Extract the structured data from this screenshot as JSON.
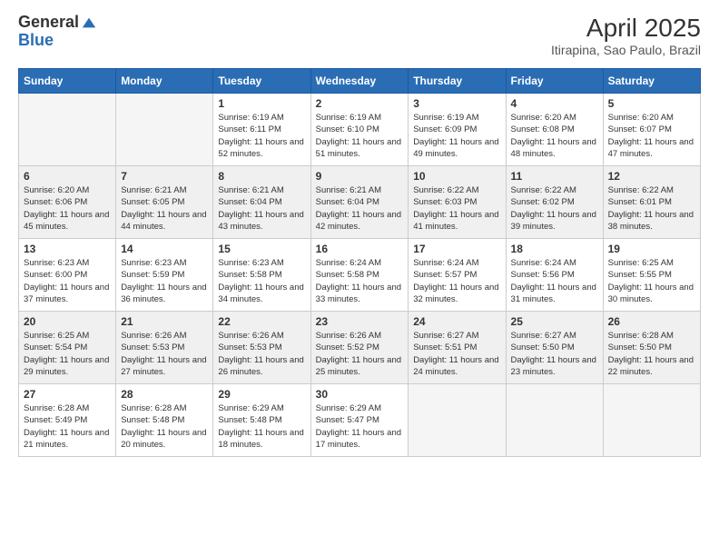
{
  "logo": {
    "general": "General",
    "blue": "Blue"
  },
  "title": "April 2025",
  "location": "Itirapina, Sao Paulo, Brazil",
  "days_of_week": [
    "Sunday",
    "Monday",
    "Tuesday",
    "Wednesday",
    "Thursday",
    "Friday",
    "Saturday"
  ],
  "weeks": [
    [
      {
        "day": null
      },
      {
        "day": null
      },
      {
        "day": 1,
        "sunrise": "Sunrise: 6:19 AM",
        "sunset": "Sunset: 6:11 PM",
        "daylight": "Daylight: 11 hours and 52 minutes."
      },
      {
        "day": 2,
        "sunrise": "Sunrise: 6:19 AM",
        "sunset": "Sunset: 6:10 PM",
        "daylight": "Daylight: 11 hours and 51 minutes."
      },
      {
        "day": 3,
        "sunrise": "Sunrise: 6:19 AM",
        "sunset": "Sunset: 6:09 PM",
        "daylight": "Daylight: 11 hours and 49 minutes."
      },
      {
        "day": 4,
        "sunrise": "Sunrise: 6:20 AM",
        "sunset": "Sunset: 6:08 PM",
        "daylight": "Daylight: 11 hours and 48 minutes."
      },
      {
        "day": 5,
        "sunrise": "Sunrise: 6:20 AM",
        "sunset": "Sunset: 6:07 PM",
        "daylight": "Daylight: 11 hours and 47 minutes."
      }
    ],
    [
      {
        "day": 6,
        "sunrise": "Sunrise: 6:20 AM",
        "sunset": "Sunset: 6:06 PM",
        "daylight": "Daylight: 11 hours and 45 minutes."
      },
      {
        "day": 7,
        "sunrise": "Sunrise: 6:21 AM",
        "sunset": "Sunset: 6:05 PM",
        "daylight": "Daylight: 11 hours and 44 minutes."
      },
      {
        "day": 8,
        "sunrise": "Sunrise: 6:21 AM",
        "sunset": "Sunset: 6:04 PM",
        "daylight": "Daylight: 11 hours and 43 minutes."
      },
      {
        "day": 9,
        "sunrise": "Sunrise: 6:21 AM",
        "sunset": "Sunset: 6:04 PM",
        "daylight": "Daylight: 11 hours and 42 minutes."
      },
      {
        "day": 10,
        "sunrise": "Sunrise: 6:22 AM",
        "sunset": "Sunset: 6:03 PM",
        "daylight": "Daylight: 11 hours and 41 minutes."
      },
      {
        "day": 11,
        "sunrise": "Sunrise: 6:22 AM",
        "sunset": "Sunset: 6:02 PM",
        "daylight": "Daylight: 11 hours and 39 minutes."
      },
      {
        "day": 12,
        "sunrise": "Sunrise: 6:22 AM",
        "sunset": "Sunset: 6:01 PM",
        "daylight": "Daylight: 11 hours and 38 minutes."
      }
    ],
    [
      {
        "day": 13,
        "sunrise": "Sunrise: 6:23 AM",
        "sunset": "Sunset: 6:00 PM",
        "daylight": "Daylight: 11 hours and 37 minutes."
      },
      {
        "day": 14,
        "sunrise": "Sunrise: 6:23 AM",
        "sunset": "Sunset: 5:59 PM",
        "daylight": "Daylight: 11 hours and 36 minutes."
      },
      {
        "day": 15,
        "sunrise": "Sunrise: 6:23 AM",
        "sunset": "Sunset: 5:58 PM",
        "daylight": "Daylight: 11 hours and 34 minutes."
      },
      {
        "day": 16,
        "sunrise": "Sunrise: 6:24 AM",
        "sunset": "Sunset: 5:58 PM",
        "daylight": "Daylight: 11 hours and 33 minutes."
      },
      {
        "day": 17,
        "sunrise": "Sunrise: 6:24 AM",
        "sunset": "Sunset: 5:57 PM",
        "daylight": "Daylight: 11 hours and 32 minutes."
      },
      {
        "day": 18,
        "sunrise": "Sunrise: 6:24 AM",
        "sunset": "Sunset: 5:56 PM",
        "daylight": "Daylight: 11 hours and 31 minutes."
      },
      {
        "day": 19,
        "sunrise": "Sunrise: 6:25 AM",
        "sunset": "Sunset: 5:55 PM",
        "daylight": "Daylight: 11 hours and 30 minutes."
      }
    ],
    [
      {
        "day": 20,
        "sunrise": "Sunrise: 6:25 AM",
        "sunset": "Sunset: 5:54 PM",
        "daylight": "Daylight: 11 hours and 29 minutes."
      },
      {
        "day": 21,
        "sunrise": "Sunrise: 6:26 AM",
        "sunset": "Sunset: 5:53 PM",
        "daylight": "Daylight: 11 hours and 27 minutes."
      },
      {
        "day": 22,
        "sunrise": "Sunrise: 6:26 AM",
        "sunset": "Sunset: 5:53 PM",
        "daylight": "Daylight: 11 hours and 26 minutes."
      },
      {
        "day": 23,
        "sunrise": "Sunrise: 6:26 AM",
        "sunset": "Sunset: 5:52 PM",
        "daylight": "Daylight: 11 hours and 25 minutes."
      },
      {
        "day": 24,
        "sunrise": "Sunrise: 6:27 AM",
        "sunset": "Sunset: 5:51 PM",
        "daylight": "Daylight: 11 hours and 24 minutes."
      },
      {
        "day": 25,
        "sunrise": "Sunrise: 6:27 AM",
        "sunset": "Sunset: 5:50 PM",
        "daylight": "Daylight: 11 hours and 23 minutes."
      },
      {
        "day": 26,
        "sunrise": "Sunrise: 6:28 AM",
        "sunset": "Sunset: 5:50 PM",
        "daylight": "Daylight: 11 hours and 22 minutes."
      }
    ],
    [
      {
        "day": 27,
        "sunrise": "Sunrise: 6:28 AM",
        "sunset": "Sunset: 5:49 PM",
        "daylight": "Daylight: 11 hours and 21 minutes."
      },
      {
        "day": 28,
        "sunrise": "Sunrise: 6:28 AM",
        "sunset": "Sunset: 5:48 PM",
        "daylight": "Daylight: 11 hours and 20 minutes."
      },
      {
        "day": 29,
        "sunrise": "Sunrise: 6:29 AM",
        "sunset": "Sunset: 5:48 PM",
        "daylight": "Daylight: 11 hours and 18 minutes."
      },
      {
        "day": 30,
        "sunrise": "Sunrise: 6:29 AM",
        "sunset": "Sunset: 5:47 PM",
        "daylight": "Daylight: 11 hours and 17 minutes."
      },
      {
        "day": null
      },
      {
        "day": null
      },
      {
        "day": null
      }
    ]
  ]
}
